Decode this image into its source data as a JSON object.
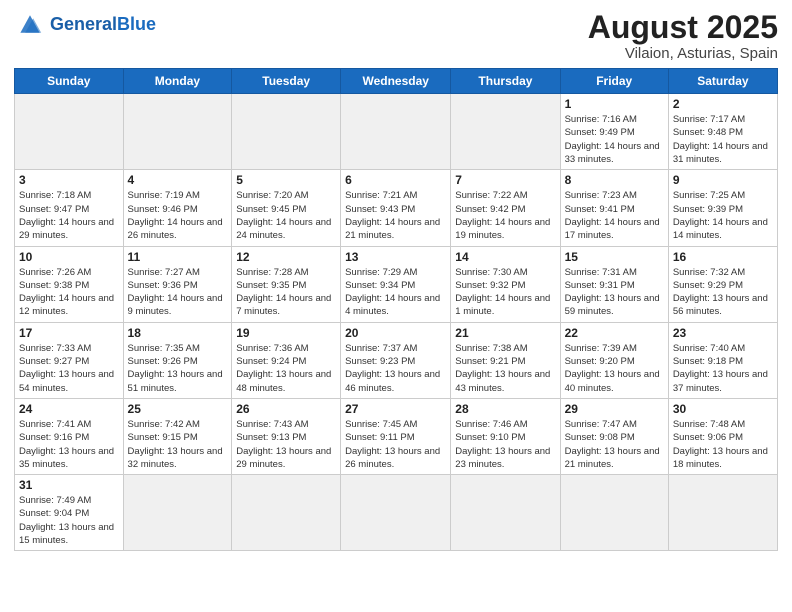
{
  "header": {
    "logo_general": "General",
    "logo_blue": "Blue",
    "month_title": "August 2025",
    "location": "Vilaion, Asturias, Spain"
  },
  "weekdays": [
    "Sunday",
    "Monday",
    "Tuesday",
    "Wednesday",
    "Thursday",
    "Friday",
    "Saturday"
  ],
  "weeks": [
    [
      {
        "day": "",
        "info": ""
      },
      {
        "day": "",
        "info": ""
      },
      {
        "day": "",
        "info": ""
      },
      {
        "day": "",
        "info": ""
      },
      {
        "day": "",
        "info": ""
      },
      {
        "day": "1",
        "info": "Sunrise: 7:16 AM\nSunset: 9:49 PM\nDaylight: 14 hours and 33 minutes."
      },
      {
        "day": "2",
        "info": "Sunrise: 7:17 AM\nSunset: 9:48 PM\nDaylight: 14 hours and 31 minutes."
      }
    ],
    [
      {
        "day": "3",
        "info": "Sunrise: 7:18 AM\nSunset: 9:47 PM\nDaylight: 14 hours and 29 minutes."
      },
      {
        "day": "4",
        "info": "Sunrise: 7:19 AM\nSunset: 9:46 PM\nDaylight: 14 hours and 26 minutes."
      },
      {
        "day": "5",
        "info": "Sunrise: 7:20 AM\nSunset: 9:45 PM\nDaylight: 14 hours and 24 minutes."
      },
      {
        "day": "6",
        "info": "Sunrise: 7:21 AM\nSunset: 9:43 PM\nDaylight: 14 hours and 21 minutes."
      },
      {
        "day": "7",
        "info": "Sunrise: 7:22 AM\nSunset: 9:42 PM\nDaylight: 14 hours and 19 minutes."
      },
      {
        "day": "8",
        "info": "Sunrise: 7:23 AM\nSunset: 9:41 PM\nDaylight: 14 hours and 17 minutes."
      },
      {
        "day": "9",
        "info": "Sunrise: 7:25 AM\nSunset: 9:39 PM\nDaylight: 14 hours and 14 minutes."
      }
    ],
    [
      {
        "day": "10",
        "info": "Sunrise: 7:26 AM\nSunset: 9:38 PM\nDaylight: 14 hours and 12 minutes."
      },
      {
        "day": "11",
        "info": "Sunrise: 7:27 AM\nSunset: 9:36 PM\nDaylight: 14 hours and 9 minutes."
      },
      {
        "day": "12",
        "info": "Sunrise: 7:28 AM\nSunset: 9:35 PM\nDaylight: 14 hours and 7 minutes."
      },
      {
        "day": "13",
        "info": "Sunrise: 7:29 AM\nSunset: 9:34 PM\nDaylight: 14 hours and 4 minutes."
      },
      {
        "day": "14",
        "info": "Sunrise: 7:30 AM\nSunset: 9:32 PM\nDaylight: 14 hours and 1 minute."
      },
      {
        "day": "15",
        "info": "Sunrise: 7:31 AM\nSunset: 9:31 PM\nDaylight: 13 hours and 59 minutes."
      },
      {
        "day": "16",
        "info": "Sunrise: 7:32 AM\nSunset: 9:29 PM\nDaylight: 13 hours and 56 minutes."
      }
    ],
    [
      {
        "day": "17",
        "info": "Sunrise: 7:33 AM\nSunset: 9:27 PM\nDaylight: 13 hours and 54 minutes."
      },
      {
        "day": "18",
        "info": "Sunrise: 7:35 AM\nSunset: 9:26 PM\nDaylight: 13 hours and 51 minutes."
      },
      {
        "day": "19",
        "info": "Sunrise: 7:36 AM\nSunset: 9:24 PM\nDaylight: 13 hours and 48 minutes."
      },
      {
        "day": "20",
        "info": "Sunrise: 7:37 AM\nSunset: 9:23 PM\nDaylight: 13 hours and 46 minutes."
      },
      {
        "day": "21",
        "info": "Sunrise: 7:38 AM\nSunset: 9:21 PM\nDaylight: 13 hours and 43 minutes."
      },
      {
        "day": "22",
        "info": "Sunrise: 7:39 AM\nSunset: 9:20 PM\nDaylight: 13 hours and 40 minutes."
      },
      {
        "day": "23",
        "info": "Sunrise: 7:40 AM\nSunset: 9:18 PM\nDaylight: 13 hours and 37 minutes."
      }
    ],
    [
      {
        "day": "24",
        "info": "Sunrise: 7:41 AM\nSunset: 9:16 PM\nDaylight: 13 hours and 35 minutes."
      },
      {
        "day": "25",
        "info": "Sunrise: 7:42 AM\nSunset: 9:15 PM\nDaylight: 13 hours and 32 minutes."
      },
      {
        "day": "26",
        "info": "Sunrise: 7:43 AM\nSunset: 9:13 PM\nDaylight: 13 hours and 29 minutes."
      },
      {
        "day": "27",
        "info": "Sunrise: 7:45 AM\nSunset: 9:11 PM\nDaylight: 13 hours and 26 minutes."
      },
      {
        "day": "28",
        "info": "Sunrise: 7:46 AM\nSunset: 9:10 PM\nDaylight: 13 hours and 23 minutes."
      },
      {
        "day": "29",
        "info": "Sunrise: 7:47 AM\nSunset: 9:08 PM\nDaylight: 13 hours and 21 minutes."
      },
      {
        "day": "30",
        "info": "Sunrise: 7:48 AM\nSunset: 9:06 PM\nDaylight: 13 hours and 18 minutes."
      }
    ],
    [
      {
        "day": "31",
        "info": "Sunrise: 7:49 AM\nSunset: 9:04 PM\nDaylight: 13 hours and 15 minutes."
      },
      {
        "day": "",
        "info": ""
      },
      {
        "day": "",
        "info": ""
      },
      {
        "day": "",
        "info": ""
      },
      {
        "day": "",
        "info": ""
      },
      {
        "day": "",
        "info": ""
      },
      {
        "day": "",
        "info": ""
      }
    ]
  ]
}
